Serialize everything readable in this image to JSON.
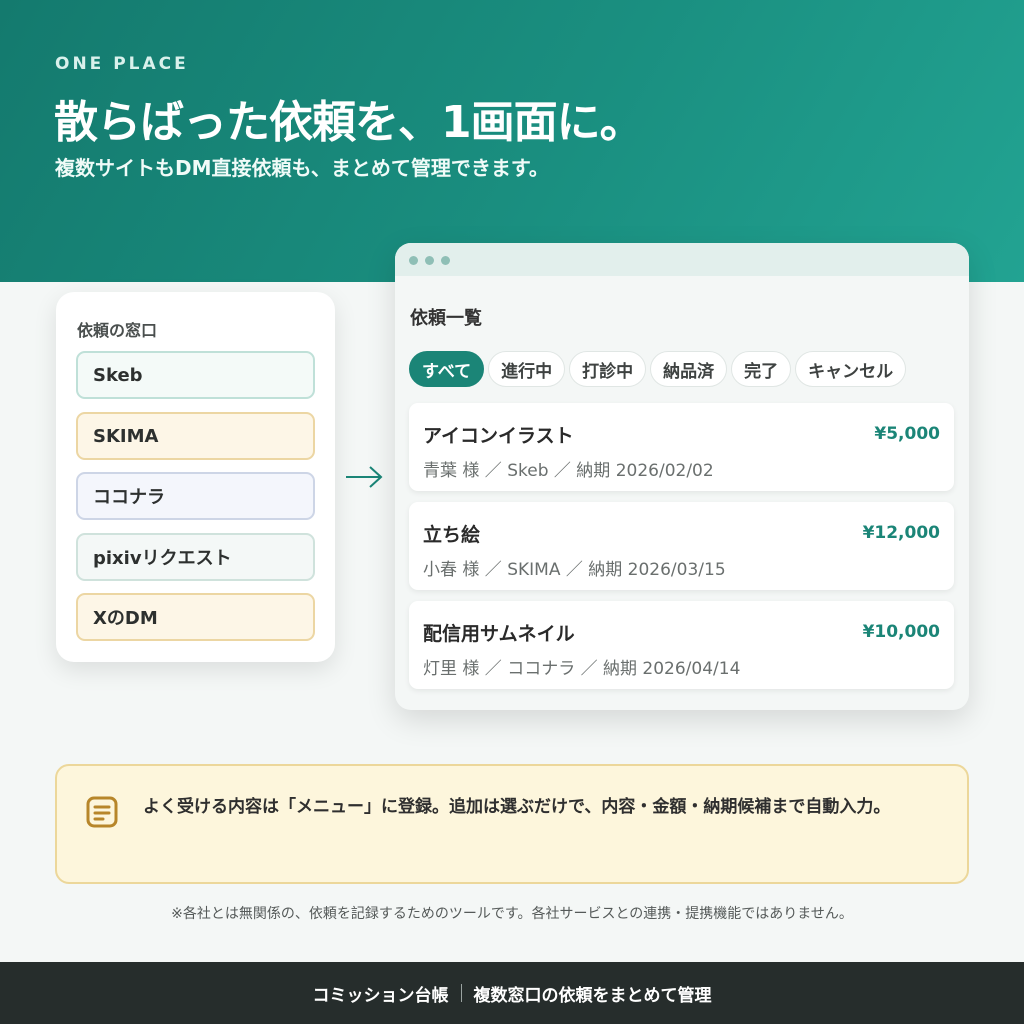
{
  "hero": {
    "eyebrow": "ONE PLACE",
    "headline": "散らばった依頼を、1画面に。",
    "subline": "複数サイトもDM直接依頼も、まとめて管理できます。"
  },
  "channels": {
    "title": "依頼の窓口",
    "items": [
      {
        "label": "Skeb",
        "bg": "#f4faf8",
        "border": "#bfe0d8"
      },
      {
        "label": "SKIMA",
        "bg": "#fdf6e7",
        "border": "#ecd6a3"
      },
      {
        "label": "ココナラ",
        "bg": "#f4f6fc",
        "border": "#cdd5e6"
      },
      {
        "label": "pixivリクエスト",
        "bg": "#f4f8f7",
        "border": "#cfe2dc"
      },
      {
        "label": "XのDM",
        "bg": "#fdf6e7",
        "border": "#ecd6a3"
      }
    ]
  },
  "window": {
    "list_title": "依頼一覧",
    "tabs": [
      "すべて",
      "進行中",
      "打診中",
      "納品済",
      "完了",
      "キャンセル"
    ],
    "active_tab": 0,
    "cards": [
      {
        "title": "アイコンイラスト",
        "price": "¥5,000",
        "meta": "青葉 様 ／ Skeb ／ 納期 2026/02/02"
      },
      {
        "title": "立ち絵",
        "price": "¥12,000",
        "meta": "小春 様 ／ SKIMA ／ 納期 2026/03/15"
      },
      {
        "title": "配信用サムネイル",
        "price": "¥10,000",
        "meta": "灯里 様 ／ ココナラ ／ 納期 2026/04/14"
      }
    ]
  },
  "note": {
    "icon": "document-list-icon",
    "text": "よく受ける内容は「メニュー」に登録。追加は選ぶだけで、内容・金額・納期候補まで自動入力。"
  },
  "disclaimer": "※各社とは無関係の、依頼を記録するためのツールです。各社サービスとの連携・提携機能ではありません。",
  "footer": {
    "app_name": "コミッション台帳",
    "tagline": "複数窓口の依頼をまとめて管理"
  },
  "colors": {
    "accent": "#1b8577",
    "hero_start": "#147a6e",
    "hero_end": "#22a392",
    "note_bg": "#fdf6dc",
    "footer_bg": "#262d2c"
  }
}
